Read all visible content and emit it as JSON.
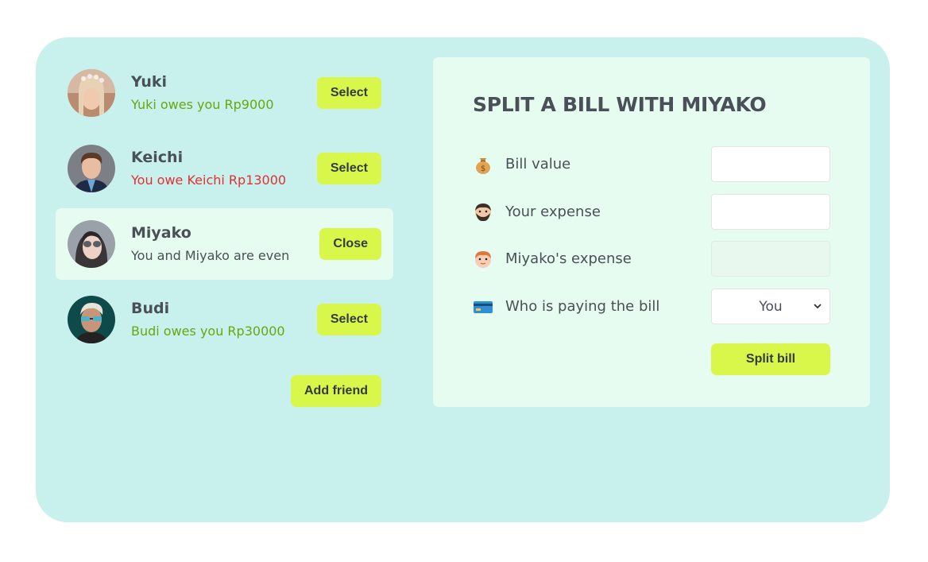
{
  "friends": [
    {
      "name": "Yuki",
      "status": "Yuki owes you Rp9000",
      "status_type": "green",
      "button": "Select",
      "selected": false
    },
    {
      "name": "Keichi",
      "status": "You owe Keichi Rp13000",
      "status_type": "red",
      "button": "Select",
      "selected": false
    },
    {
      "name": "Miyako",
      "status": "You and Miyako are even",
      "status_type": "even",
      "button": "Close",
      "selected": true
    },
    {
      "name": "Budi",
      "status": "Budi owes you Rp30000",
      "status_type": "green",
      "button": "Select",
      "selected": false
    }
  ],
  "add_friend_label": "Add friend",
  "split": {
    "title": "SPLIT A BILL WITH MIYAKO",
    "bill_value": {
      "icon": "money-bag-icon",
      "label": "Bill value",
      "value": ""
    },
    "your_expense": {
      "icon": "bearded-face-icon",
      "label": "Your expense",
      "value": ""
    },
    "friend_expense": {
      "icon": "red-haired-face-icon",
      "label": "Miyako's expense",
      "value": ""
    },
    "payer": {
      "icon": "credit-card-icon",
      "label": "Who is paying the bill",
      "selected": "You"
    },
    "submit_label": "Split bill"
  },
  "colors": {
    "app_bg": "#c8f0ec",
    "panel_bg": "#e6fcf0",
    "accent": "#d9f74a",
    "owes_you": "#66a80f",
    "you_owe": "#e03131"
  }
}
